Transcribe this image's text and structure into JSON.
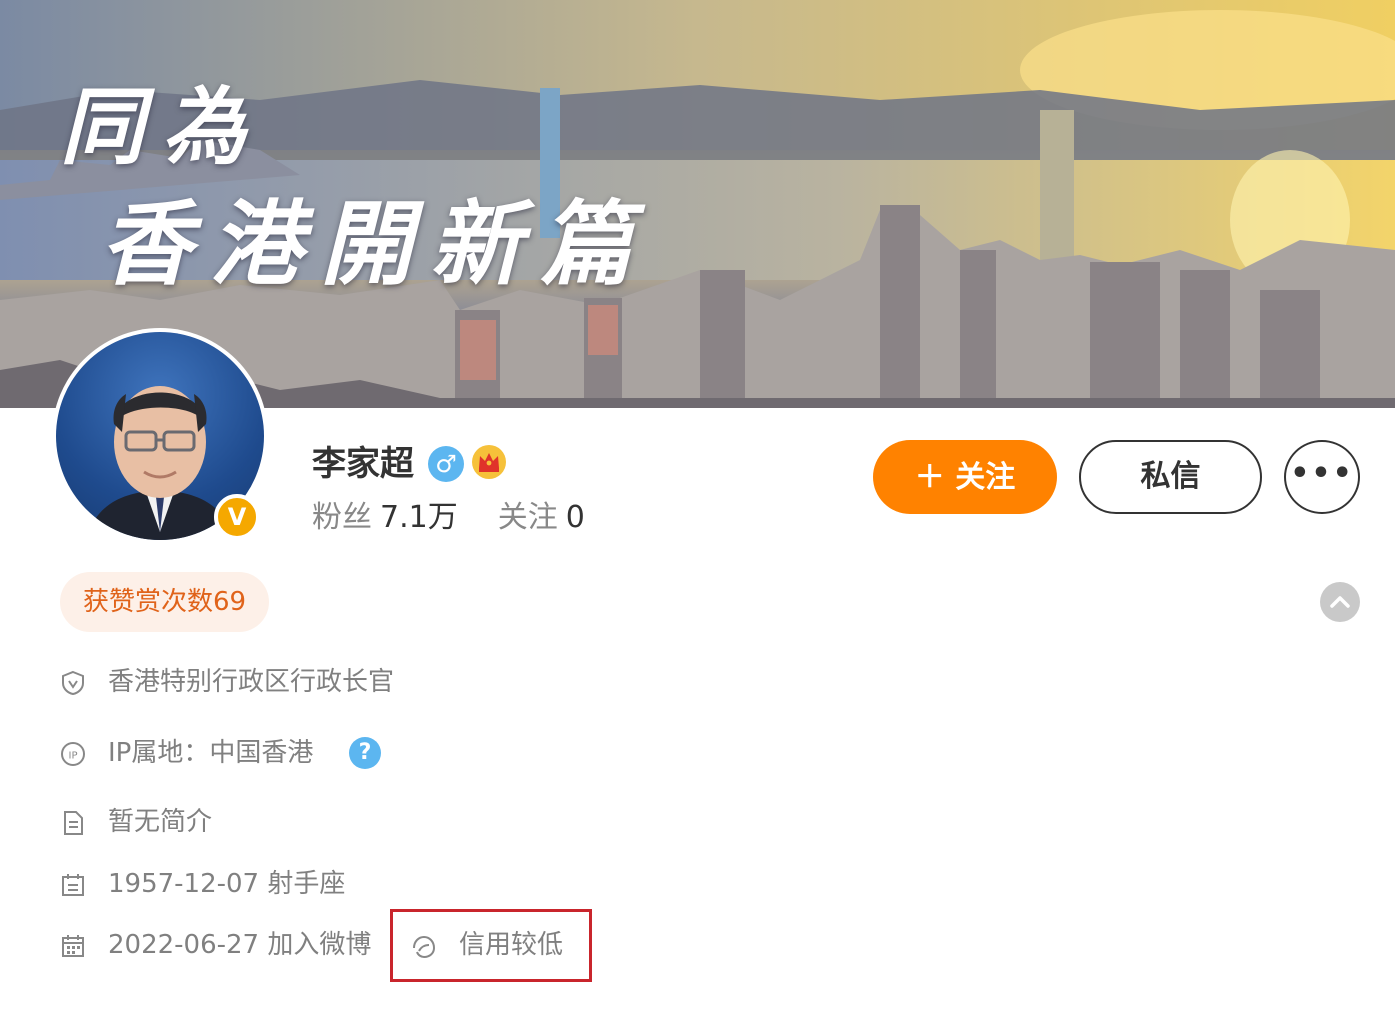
{
  "cover": {
    "title_line1": "同為",
    "title_line2": "香港開新篇"
  },
  "profile": {
    "name": "李家超",
    "gender_symbol": "♂",
    "verified_badge": "V",
    "fans_label": "粉丝",
    "fans_count": "7.1万",
    "following_label": "关注",
    "following_count": "0"
  },
  "actions": {
    "follow_label": "＋ 关注",
    "message_label": "私信",
    "more_label": "•••"
  },
  "reward": {
    "label": "获赞赏次数69"
  },
  "info": {
    "title": "香港特别行政区行政长官",
    "ip_location": "IP属地：中国香港",
    "help_symbol": "?",
    "bio": "暂无简介",
    "birthday": "1957-12-07 射手座",
    "joined": "2022-06-27 加入微博",
    "credit": "信用较低"
  },
  "colors": {
    "accent": "#ff8200",
    "verified": "#f5a800",
    "info_blue": "#5cb6f0",
    "highlight_box": "#c9252c",
    "reward_text": "#e0631a",
    "reward_bg": "#fdf0e8"
  },
  "icons": [
    "verified-v-icon",
    "gender-male-icon",
    "crown-icon",
    "shield-v-icon",
    "ip-icon",
    "help-icon",
    "document-icon",
    "calendar-icon",
    "calendar-grid-icon",
    "credit-leaf-icon",
    "chevron-up-icon",
    "more-dots-icon"
  ]
}
